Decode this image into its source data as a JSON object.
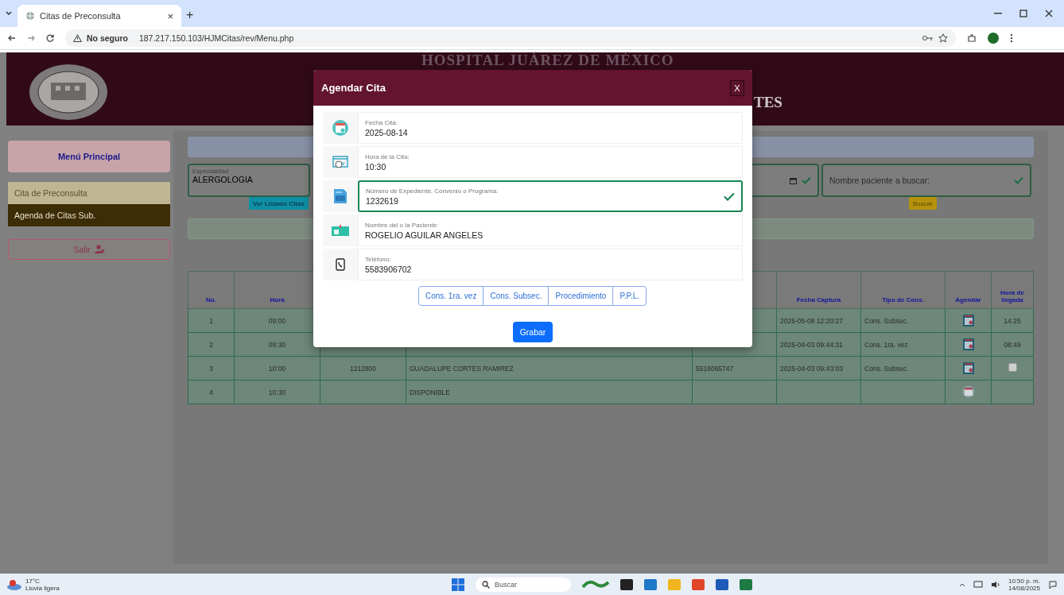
{
  "browser": {
    "tab": {
      "title": "Citas de Preconsulta",
      "close": "×"
    },
    "new_tab": "+",
    "security": "No seguro",
    "url": "187.217.150.103/HJMCitas/rev/Menu.php"
  },
  "header": {
    "title": "HOSPITAL JUÁREZ DE MÉXICO",
    "subtitle_fragment": "TES"
  },
  "sidebar": {
    "title": "Menú Principal",
    "items": [
      {
        "label": "Cita de Preconsulta",
        "selected": false
      },
      {
        "label": "Agenda de Citas Sub.",
        "selected": true
      }
    ],
    "logout": "Salir"
  },
  "filters": {
    "specialty": {
      "label": "Especialidad",
      "value": "ALERGOLOGIA",
      "valid": true
    },
    "date": {
      "valid": true
    },
    "patient_search": {
      "placeholder": "Nombre paciente a buscar:",
      "valid": true
    },
    "list_button": "Ver Listado Citas",
    "search_button": "Buscar"
  },
  "table": {
    "columns": {
      "no": "No.",
      "time": "Hora",
      "captured": "Fecha Captura",
      "type": "Tipo de Cons.",
      "schedule": "Agendar",
      "arrival": "Hora de llegada"
    },
    "rows": [
      {
        "no": "1",
        "time": "09:00",
        "captured": "2025-05-08 12:20:27",
        "type": "Cons. Subsec.",
        "schedule": {
          "kind": "booked"
        },
        "arrival": {
          "kind": "text",
          "text": "14:25"
        }
      },
      {
        "no": "2",
        "time": "09:30",
        "captured": "2025-04-03 09:44:31",
        "type": "Cons. 1ra. vez",
        "schedule": {
          "kind": "booked"
        },
        "arrival": {
          "kind": "text",
          "text": "08:49"
        }
      },
      {
        "no": "3",
        "time": "10:00",
        "record": "1212800",
        "patient": "GUADALUPE CORTES RAMIREZ",
        "phone": "5516065747",
        "captured": "2025-04-03 09:43:03",
        "type": "Cons. Subsec.",
        "schedule": {
          "kind": "booked"
        },
        "arrival": {
          "kind": "checkbox",
          "checked": false
        }
      },
      {
        "no": "4",
        "time": "10:30",
        "patient": "DISPONIBLE",
        "schedule": {
          "kind": "available"
        }
      }
    ]
  },
  "modal": {
    "title": "Agendar Cita",
    "close": "X",
    "fields": [
      {
        "label": "Fecha Cita:",
        "value": "2025-08-14",
        "valid": false
      },
      {
        "label": "Hora de la Cita:",
        "value": "10:30",
        "valid": false
      },
      {
        "label": "Número de Expediente, Convenio o Programa:",
        "value": "1232619",
        "valid": true
      },
      {
        "label": "Nombre del o la Paciente:",
        "value": "ROGELIO AGUILAR ANGELES",
        "valid": false
      },
      {
        "label": "Teléfono:",
        "value": "5583906702",
        "valid": false
      }
    ],
    "types": [
      {
        "label": "Cons. 1ra. vez",
        "selected": false
      },
      {
        "label": "Cons. Subsec.",
        "selected": false
      },
      {
        "label": "Procedimiento",
        "selected": false
      },
      {
        "label": "P.P.L.",
        "selected": false
      }
    ],
    "save": "Grabar"
  },
  "taskbar": {
    "weather": {
      "temp": "17°C",
      "desc": "Lluvia ligera"
    },
    "search": {
      "placeholder": "Buscar"
    },
    "time": "10:50 p. m.",
    "date": "14/08/2025"
  }
}
